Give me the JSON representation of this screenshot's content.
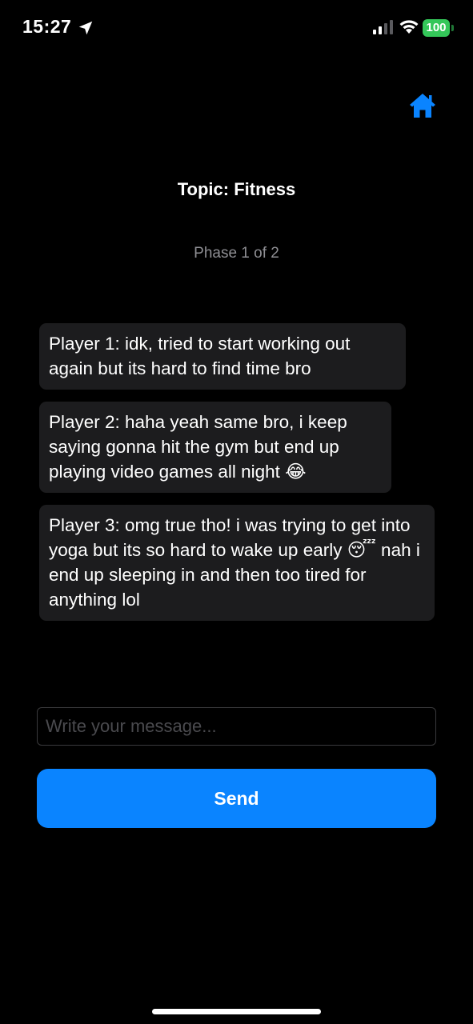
{
  "status_bar": {
    "time": "15:27",
    "battery": "100",
    "icons": [
      "location-arrow-icon",
      "cellular-signal-icon",
      "wifi-icon",
      "battery-icon"
    ]
  },
  "header": {
    "home_icon": "home-icon",
    "accent_color": "#0a84ff"
  },
  "topic": "Topic: Fitness",
  "phase": "Phase 1 of 2",
  "messages": [
    {
      "text": "Player 1: idk, tried to start working out again but its hard to find time bro"
    },
    {
      "text": "Player 2: haha yeah same bro, i keep saying gonna hit the gym but end up playing video games all night 😂"
    },
    {
      "text": "Player 3: omg true tho! i was trying to get into yoga but its so hard to wake up early 😴 nah i end up sleeping in and then too tired for anything lol"
    }
  ],
  "composer": {
    "placeholder": "Write your message...",
    "send_label": "Send"
  },
  "colors": {
    "background": "#000000",
    "bubble": "#1c1c1e",
    "send_button": "#0a84ff",
    "battery": "#34c759"
  }
}
